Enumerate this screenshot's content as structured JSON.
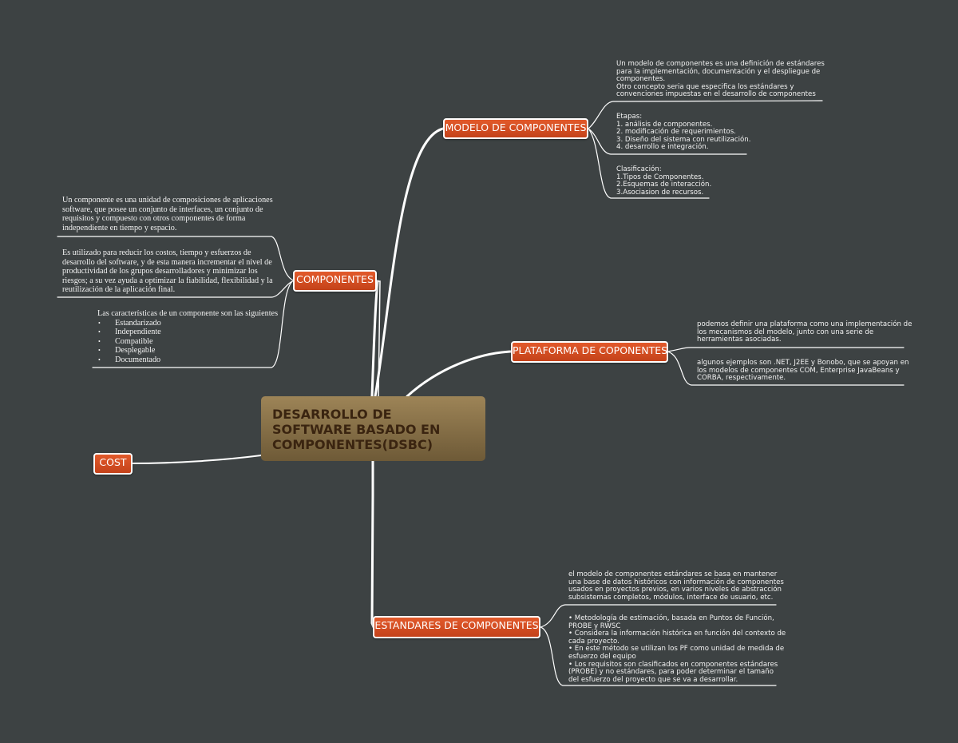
{
  "central_topic": "DESARROLLO DE SOFTWARE BASADO EN COMPONENTES(DSBC)",
  "colors": {
    "background": "#3d4243",
    "topic_fill": "#d54e22",
    "central_fill": "#8a7149",
    "central_text": "#3a2410",
    "connector": "#ffffff"
  },
  "topics": {
    "modelo": {
      "label": "MODELO DE COMPONENTES",
      "notes": [
        "Un modelo de componentes es una definición de estándares\npara la implementación, documentación y el despliegue de\ncomponentes.\nOtro concepto seria que especifica los estándares y\nconvenciones impuestas en el desarrollo de componentes",
        "Etapas:\n1. análisis de componentes.\n2. modificación de requerimientos.\n3. Diseño del sistema con reutilización.\n4. desarrollo e integración.",
        "Clasificación:\n1.Tipos de Componentes.\n2.Esquemas de interacción.\n3.Asociasion de recursos."
      ]
    },
    "componentes": {
      "label": "COMPONENTES",
      "notes": [
        "Un componente es una unidad de composiciones de aplicaciones\nsoftware, que posee un conjunto de interfaces, un conjunto de\nrequisitos y compuesto con otros componentes de forma\nindependiente en tiempo y espacio.",
        "Es utilizado para reducir los costos, tiempo y esfuerzos de\ndesarrollo del software, y de esta manera incrementar el nivel de\nproductividad de los grupos desarrolladores y minimizar los\nriesgos; a su vez ayuda a optimizar la fiabilidad, flexibilidad y la\nreutilización de la aplicación final."
      ],
      "caracteristicas": {
        "intro": "Las características de un componente son las siguientes",
        "items": [
          "Estandarizado",
          "Independiente",
          "Compatible",
          "Desplegable",
          "Documentado"
        ]
      }
    },
    "plataforma": {
      "label": "PLATAFORMA DE COPONENTES",
      "notes": [
        "podemos definir una plataforma como una implementación de\nlos mecanismos del modelo, junto con una serie de\nherramientas asociadas.",
        "algunos ejemplos son .NET, J2EE y Bonobo, que se apoyan en\nlos modelos de componentes COM, Enterprise JavaBeans y\nCORBA, respectivamente."
      ]
    },
    "estandares": {
      "label": "ESTANDARES DE COMPONENTES",
      "notes": [
        "el modelo de componentes estándares se basa en mantener\nuna base de datos históricos con información de componentes\nusados en proyectos previos, en varios niveles de abstracción\nsubsistemas completos, módulos, interface de usuario, etc.",
        "• Metodología de estimación, basada en Puntos de Función,\nPROBE y RWSC\n• Considera la información histórica en función del contexto de\ncada proyecto.\n• En este método se utilizan los PF como unidad de medida de\nesfuerzo del equipo\n• Los requisitos son clasificados en componentes estándares\n(PROBE) y no estándares, para poder determinar el tamaño\ndel esfuerzo del proyecto que se va a desarrollar."
      ]
    },
    "cost": {
      "label": "COST"
    }
  }
}
